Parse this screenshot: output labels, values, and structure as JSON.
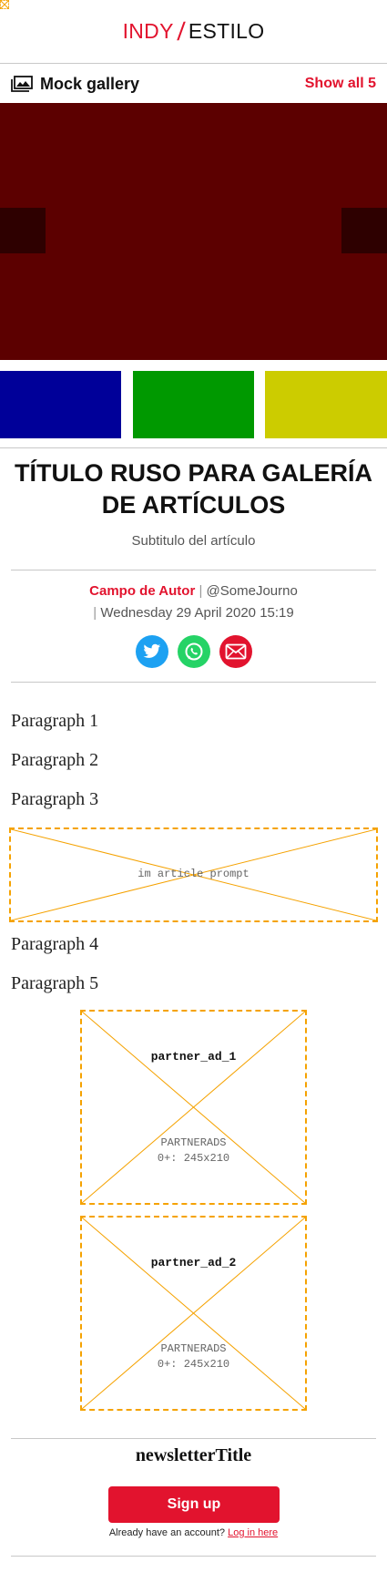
{
  "header": {
    "logo_left": "INDY",
    "logo_slash": "/",
    "logo_right": "ESTILO"
  },
  "gallery": {
    "title": "Mock gallery",
    "show_all_label": "Show all 5",
    "main_image_color": "#5c0000",
    "thumbnail_colors": [
      "#000099",
      "#009900",
      "#cccc00"
    ]
  },
  "article": {
    "title": "TÍTULO RUSO PARA GALERÍA DE ARTÍCULOS",
    "subtitle": "Subtitulo del artículo",
    "author": "Campo de Autor",
    "handle": "@SomeJourno",
    "date": "Wednesday 29 April 2020 15:19",
    "separator": "|",
    "paragraphs": [
      "Paragraph 1",
      "Paragraph 2",
      "Paragraph 3",
      "Paragraph 4",
      "Paragraph 5"
    ]
  },
  "share": {
    "icons": [
      "twitter-icon",
      "whatsapp-icon",
      "email-icon"
    ]
  },
  "ads": {
    "in_article_prompt": "im article prompt",
    "partner_1": {
      "name": "partner_ad_1",
      "line1": "PARTNERADS",
      "line2": "0+: 245x210"
    },
    "partner_2": {
      "name": "partner_ad_2",
      "line1": "PARTNERADS",
      "line2": "0+: 245x210"
    }
  },
  "newsletter": {
    "title": "newsletterTitle",
    "signup_label": "Sign up",
    "login_prompt": "Already have an account?",
    "login_link": "Log in here"
  },
  "colors": {
    "brand_red": "#e2132e",
    "ad_outline": "#f5a200"
  }
}
